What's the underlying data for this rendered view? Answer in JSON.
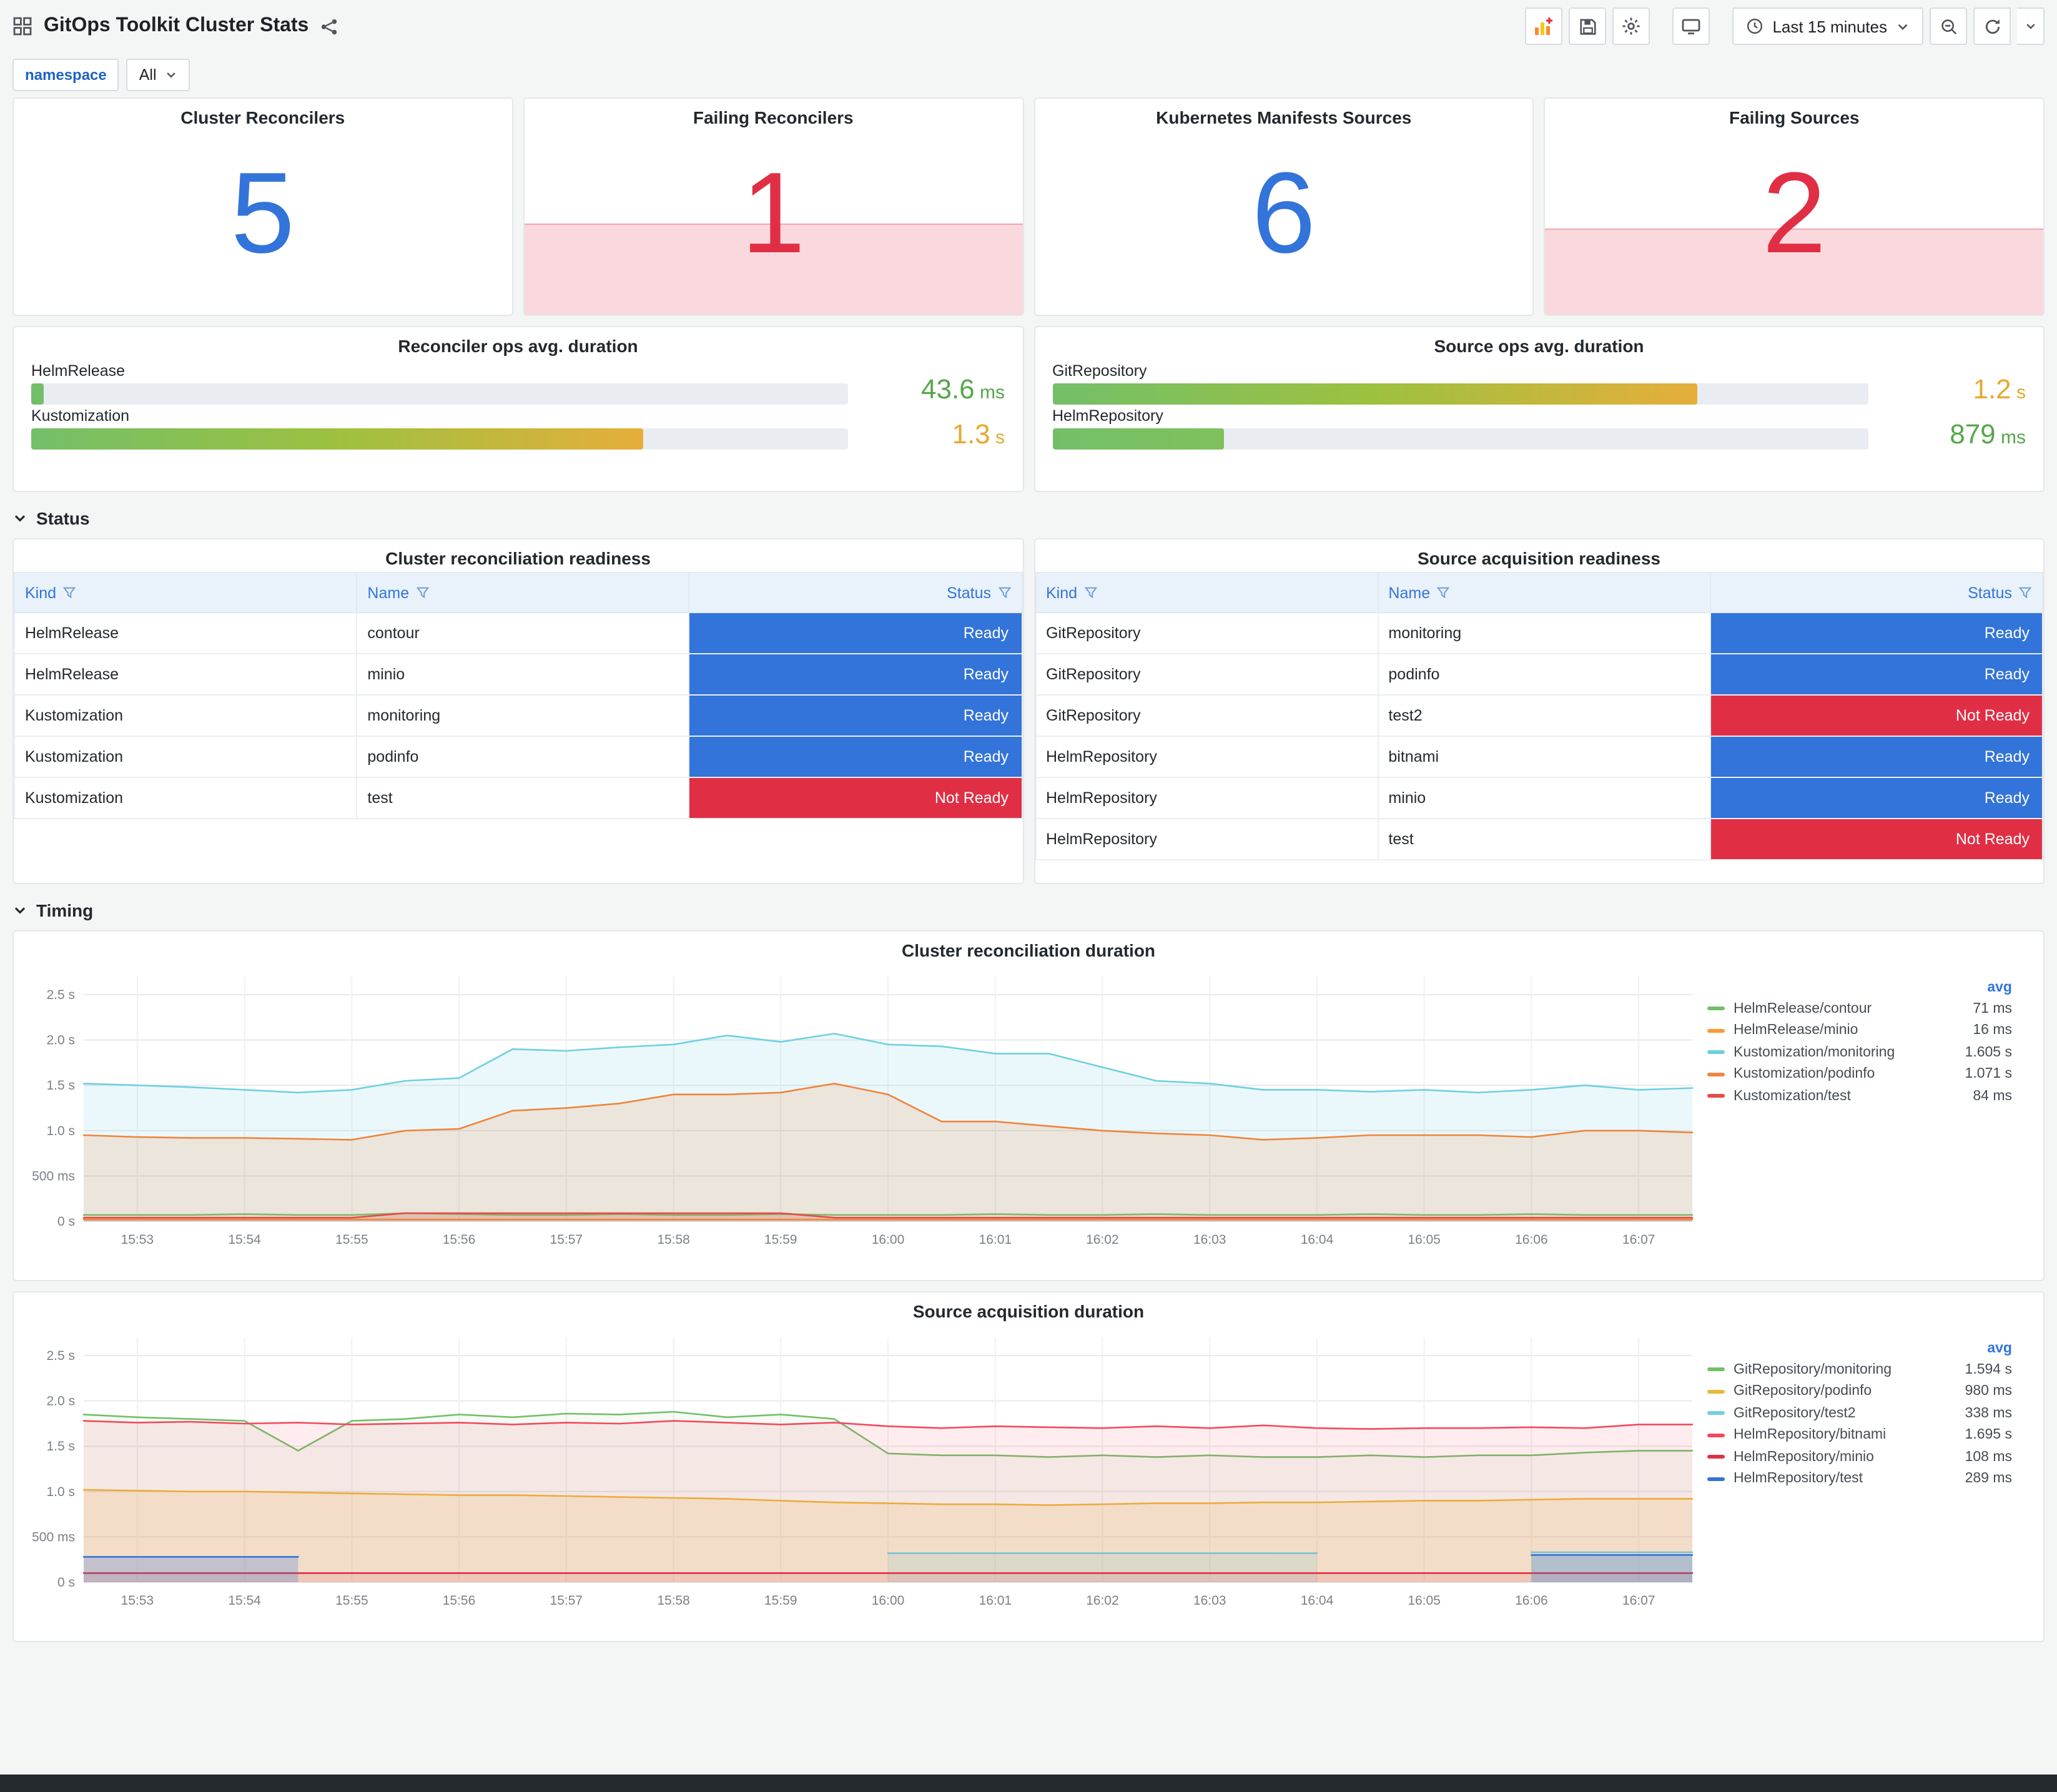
{
  "header": {
    "title": "GitOps Toolkit Cluster Stats",
    "time_range": "Last 15 minutes"
  },
  "variables": {
    "namespace_label": "namespace",
    "namespace_value": "All"
  },
  "sections": {
    "status": "Status",
    "timing": "Timing"
  },
  "colors": {
    "ok": "#3274D9",
    "alert": "#E02F44",
    "status_map": {
      "Ready": "#3274D9",
      "Not Ready": "#E02F44"
    }
  },
  "stat_panels": [
    {
      "title": "Cluster Reconcilers",
      "value": "5",
      "state": "ok",
      "spark_height": 0
    },
    {
      "title": "Failing Reconcilers",
      "value": "1",
      "state": "alert",
      "spark_height": 0.42
    },
    {
      "title": "Kubernetes Manifests Sources",
      "value": "6",
      "state": "ok",
      "spark_height": 0
    },
    {
      "title": "Failing Sources",
      "value": "2",
      "state": "alert",
      "spark_height": 0.4
    }
  ],
  "gauge_panels": [
    {
      "title": "Reconciler ops avg. duration",
      "bars": [
        {
          "label": "HelmRelease",
          "pct": 1.6,
          "gradient": [
            "#73BF69",
            "#73BF69"
          ],
          "value": "43.6",
          "unit": "ms",
          "value_color": "#56A64B"
        },
        {
          "label": "Kustomization",
          "pct": 75,
          "gradient": [
            "#73BF69",
            "#9DC13F",
            "#E6AE3B"
          ],
          "value": "1.3",
          "unit": "s",
          "value_color": "#E8A72E"
        }
      ]
    },
    {
      "title": "Source ops avg. duration",
      "bars": [
        {
          "label": "GitRepository",
          "pct": 79,
          "gradient": [
            "#73BF69",
            "#9DC13F",
            "#E6AE3B"
          ],
          "value": "1.2",
          "unit": "s",
          "value_color": "#E8A72E"
        },
        {
          "label": "HelmRepository",
          "pct": 21,
          "gradient": [
            "#73BF69",
            "#7FC15C"
          ],
          "value": "879",
          "unit": "ms",
          "value_color": "#56A64B"
        }
      ]
    }
  ],
  "tables": [
    {
      "title": "Cluster reconciliation readiness",
      "columns": [
        "Kind",
        "Name",
        "Status"
      ],
      "rows": [
        {
          "kind": "HelmRelease",
          "name": "contour",
          "status": "Ready"
        },
        {
          "kind": "HelmRelease",
          "name": "minio",
          "status": "Ready"
        },
        {
          "kind": "Kustomization",
          "name": "monitoring",
          "status": "Ready"
        },
        {
          "kind": "Kustomization",
          "name": "podinfo",
          "status": "Ready"
        },
        {
          "kind": "Kustomization",
          "name": "test",
          "status": "Not Ready"
        }
      ]
    },
    {
      "title": "Source acquisition readiness",
      "columns": [
        "Kind",
        "Name",
        "Status"
      ],
      "rows": [
        {
          "kind": "GitRepository",
          "name": "monitoring",
          "status": "Ready"
        },
        {
          "kind": "GitRepository",
          "name": "podinfo",
          "status": "Ready"
        },
        {
          "kind": "GitRepository",
          "name": "test2",
          "status": "Not Ready"
        },
        {
          "kind": "HelmRepository",
          "name": "bitnami",
          "status": "Ready"
        },
        {
          "kind": "HelmRepository",
          "name": "minio",
          "status": "Ready"
        },
        {
          "kind": "HelmRepository",
          "name": "test",
          "status": "Not Ready"
        }
      ]
    }
  ],
  "chart_data": [
    {
      "type": "area",
      "title": "Cluster reconciliation duration",
      "legend_header": "avg",
      "legend_position": "right",
      "grid": true,
      "x_domain": [
        52.5,
        67.5
      ],
      "x_start": 52.5,
      "x_step": 0.5,
      "ylim": [
        0,
        2.7
      ],
      "y_ticks": [
        {
          "v": 0,
          "label": "0 s"
        },
        {
          "v": 0.5,
          "label": "500 ms"
        },
        {
          "v": 1.0,
          "label": "1.0 s"
        },
        {
          "v": 1.5,
          "label": "1.5 s"
        },
        {
          "v": 2.0,
          "label": "2.0 s"
        },
        {
          "v": 2.5,
          "label": "2.5 s"
        }
      ],
      "x_ticks": [
        {
          "v": 53,
          "label": "15:53"
        },
        {
          "v": 54,
          "label": "15:54"
        },
        {
          "v": 55,
          "label": "15:55"
        },
        {
          "v": 56,
          "label": "15:56"
        },
        {
          "v": 57,
          "label": "15:57"
        },
        {
          "v": 58,
          "label": "15:58"
        },
        {
          "v": 59,
          "label": "15:59"
        },
        {
          "v": 60,
          "label": "16:00"
        },
        {
          "v": 61,
          "label": "16:01"
        },
        {
          "v": 62,
          "label": "16:02"
        },
        {
          "v": 63,
          "label": "16:03"
        },
        {
          "v": 64,
          "label": "16:04"
        },
        {
          "v": 65,
          "label": "16:05"
        },
        {
          "v": 66,
          "label": "16:06"
        },
        {
          "v": 67,
          "label": "16:07"
        }
      ],
      "series": [
        {
          "name": "HelmRelease/contour",
          "avg": "71 ms",
          "color": "#73BF69",
          "fill_opacity": 0.1,
          "values": [
            0.07,
            0.07,
            0.07,
            0.08,
            0.07,
            0.07,
            0.09,
            0.08,
            0.07,
            0.07,
            0.08,
            0.07,
            0.07,
            0.08,
            0.07,
            0.07,
            0.07,
            0.08,
            0.07,
            0.07,
            0.08,
            0.07,
            0.07,
            0.07,
            0.08,
            0.07,
            0.07,
            0.08,
            0.07,
            0.07,
            0.07
          ]
        },
        {
          "name": "HelmRelease/minio",
          "avg": "16 ms",
          "color": "#FF9830",
          "fill_opacity": 0.1,
          "values": [
            0.02,
            0.02,
            0.02,
            0.02,
            0.02,
            0.02,
            0.02,
            0.02,
            0.02,
            0.02,
            0.02,
            0.02,
            0.02,
            0.02,
            0.02,
            0.02,
            0.02,
            0.02,
            0.02,
            0.02,
            0.02,
            0.02,
            0.02,
            0.02,
            0.02,
            0.02,
            0.02,
            0.02,
            0.02,
            0.02,
            0.02
          ]
        },
        {
          "name": "Kustomization/monitoring",
          "avg": "1.605 s",
          "color": "#6ED0E0",
          "fill_opacity": 0.14,
          "values": [
            1.52,
            1.5,
            1.48,
            1.45,
            1.42,
            1.45,
            1.55,
            1.58,
            1.9,
            1.88,
            1.92,
            1.95,
            2.05,
            1.98,
            2.07,
            1.95,
            1.93,
            1.85,
            1.85,
            1.7,
            1.55,
            1.52,
            1.45,
            1.45,
            1.43,
            1.45,
            1.42,
            1.45,
            1.5,
            1.45,
            1.47
          ]
        },
        {
          "name": "Kustomization/podinfo",
          "avg": "1.071 s",
          "color": "#EF843C",
          "fill_opacity": 0.16,
          "values": [
            0.95,
            0.93,
            0.92,
            0.92,
            0.91,
            0.9,
            1.0,
            1.02,
            1.22,
            1.25,
            1.3,
            1.4,
            1.4,
            1.42,
            1.52,
            1.4,
            1.1,
            1.1,
            1.05,
            1.0,
            0.97,
            0.95,
            0.9,
            0.92,
            0.95,
            0.95,
            0.95,
            0.93,
            1.0,
            1.0,
            0.98
          ]
        },
        {
          "name": "Kustomization/test",
          "avg": "84 ms",
          "color": "#E24D42",
          "fill_opacity": 0.2,
          "values": [
            0.04,
            0.04,
            0.04,
            0.04,
            0.04,
            0.04,
            0.09,
            0.09,
            0.09,
            0.09,
            0.09,
            0.09,
            0.09,
            0.09,
            0.04,
            0.04,
            0.04,
            0.04,
            0.04,
            0.04,
            0.04,
            0.04,
            0.04,
            0.04,
            0.04,
            0.04,
            0.04,
            0.04,
            0.04,
            0.04,
            0.04
          ]
        }
      ]
    },
    {
      "type": "area",
      "title": "Source acquisition duration",
      "legend_header": "avg",
      "legend_position": "right",
      "grid": true,
      "x_domain": [
        52.5,
        67.5
      ],
      "x_start": 52.5,
      "x_step": 0.5,
      "ylim": [
        0,
        2.7
      ],
      "y_ticks": [
        {
          "v": 0,
          "label": "0 s"
        },
        {
          "v": 0.5,
          "label": "500 ms"
        },
        {
          "v": 1.0,
          "label": "1.0 s"
        },
        {
          "v": 1.5,
          "label": "1.5 s"
        },
        {
          "v": 2.0,
          "label": "2.0 s"
        },
        {
          "v": 2.5,
          "label": "2.5 s"
        }
      ],
      "x_ticks": [
        {
          "v": 53,
          "label": "15:53"
        },
        {
          "v": 54,
          "label": "15:54"
        },
        {
          "v": 55,
          "label": "15:55"
        },
        {
          "v": 56,
          "label": "15:56"
        },
        {
          "v": 57,
          "label": "15:57"
        },
        {
          "v": 58,
          "label": "15:58"
        },
        {
          "v": 59,
          "label": "15:59"
        },
        {
          "v": 60,
          "label": "16:00"
        },
        {
          "v": 61,
          "label": "16:01"
        },
        {
          "v": 62,
          "label": "16:02"
        },
        {
          "v": 63,
          "label": "16:03"
        },
        {
          "v": 64,
          "label": "16:04"
        },
        {
          "v": 65,
          "label": "16:05"
        },
        {
          "v": 66,
          "label": "16:06"
        },
        {
          "v": 67,
          "label": "16:07"
        }
      ],
      "series": [
        {
          "name": "GitRepository/monitoring",
          "avg": "1.594 s",
          "color": "#73BF69",
          "fill_opacity": 0.07,
          "values": [
            1.85,
            1.82,
            1.8,
            1.78,
            1.45,
            1.78,
            1.8,
            1.85,
            1.82,
            1.86,
            1.85,
            1.88,
            1.82,
            1.85,
            1.8,
            1.42,
            1.4,
            1.4,
            1.38,
            1.4,
            1.38,
            1.4,
            1.38,
            1.38,
            1.4,
            1.38,
            1.4,
            1.4,
            1.43,
            1.45,
            1.45
          ]
        },
        {
          "name": "GitRepository/podinfo",
          "avg": "980 ms",
          "color": "#EAB839",
          "fill_opacity": 0.16,
          "values": [
            1.02,
            1.01,
            1.0,
            1.0,
            0.99,
            0.98,
            0.97,
            0.96,
            0.96,
            0.95,
            0.94,
            0.93,
            0.92,
            0.9,
            0.88,
            0.87,
            0.86,
            0.86,
            0.85,
            0.86,
            0.87,
            0.87,
            0.88,
            0.88,
            0.89,
            0.9,
            0.9,
            0.91,
            0.92,
            0.92,
            0.92
          ]
        },
        {
          "name": "GitRepository/test2",
          "avg": "338 ms",
          "color": "#6ED0E0",
          "fill_opacity": 0.18,
          "values": [
            null,
            null,
            null,
            null,
            null,
            null,
            null,
            null,
            null,
            null,
            null,
            null,
            null,
            null,
            null,
            0.32,
            0.32,
            0.32,
            0.32,
            0.32,
            0.32,
            0.32,
            0.32,
            0.32,
            null,
            null,
            null,
            0.33,
            0.33,
            0.33,
            0.33
          ]
        },
        {
          "name": "HelmRepository/bitnami",
          "avg": "1.695 s",
          "color": "#F2495C",
          "fill_opacity": 0.1,
          "values": [
            1.78,
            1.76,
            1.77,
            1.75,
            1.76,
            1.74,
            1.75,
            1.76,
            1.74,
            1.76,
            1.75,
            1.78,
            1.76,
            1.74,
            1.76,
            1.72,
            1.7,
            1.72,
            1.71,
            1.7,
            1.72,
            1.7,
            1.73,
            1.7,
            1.69,
            1.7,
            1.7,
            1.71,
            1.7,
            1.74,
            1.74
          ]
        },
        {
          "name": "HelmRepository/minio",
          "avg": "108 ms",
          "color": "#E02F44",
          "fill_opacity": 0.12,
          "values": [
            0.1,
            0.1,
            0.1,
            0.1,
            0.1,
            0.1,
            0.1,
            0.1,
            0.1,
            0.1,
            0.1,
            0.1,
            0.1,
            0.1,
            0.1,
            0.1,
            0.1,
            0.1,
            0.1,
            0.1,
            0.1,
            0.1,
            0.1,
            0.1,
            0.1,
            0.1,
            0.1,
            0.1,
            0.1,
            0.1,
            0.1
          ]
        },
        {
          "name": "HelmRepository/test",
          "avg": "289 ms",
          "color": "#3274D9",
          "fill_opacity": 0.25,
          "values": [
            0.28,
            0.28,
            0.28,
            0.28,
            0.28,
            null,
            null,
            null,
            null,
            null,
            null,
            null,
            null,
            null,
            null,
            null,
            null,
            null,
            null,
            null,
            null,
            null,
            null,
            null,
            null,
            null,
            null,
            0.3,
            0.3,
            0.3,
            0.3
          ]
        }
      ]
    }
  ]
}
